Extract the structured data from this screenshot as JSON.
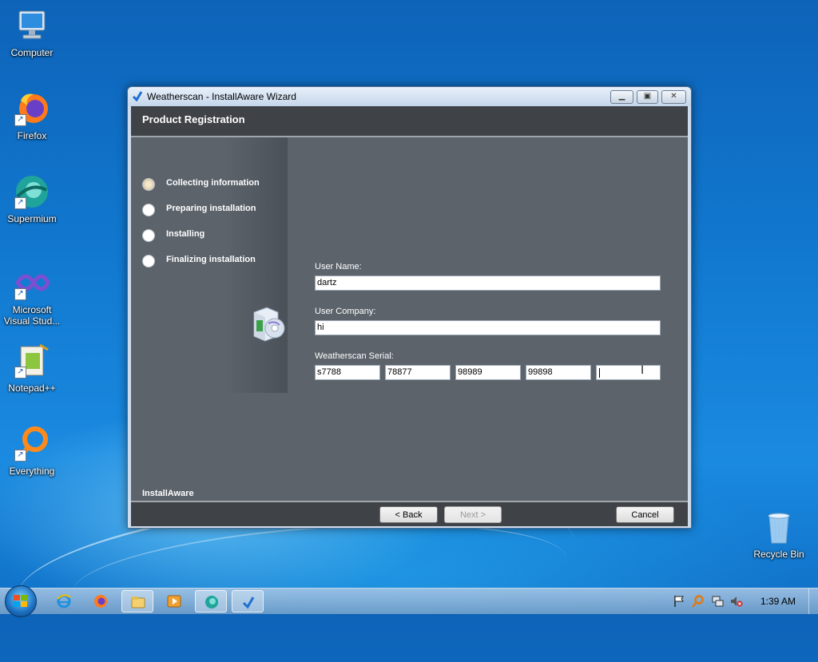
{
  "desktop": {
    "icons": [
      {
        "label": "Computer",
        "icon": "computer-icon"
      },
      {
        "label": "Firefox",
        "icon": "firefox-icon"
      },
      {
        "label": "Supermium",
        "icon": "supermium-icon"
      },
      {
        "label": "Microsoft Visual Stud...",
        "icon": "visual-studio-icon"
      },
      {
        "label": "Notepad++",
        "icon": "notepad-plus-plus-icon"
      },
      {
        "label": "Everything",
        "icon": "everything-search-icon"
      },
      {
        "label": "Recycle Bin",
        "icon": "recycle-bin-icon"
      }
    ]
  },
  "window": {
    "title": "Weatherscan - InstallAware Wizard",
    "controls": {
      "minimize": "minimize",
      "maximize": "maximize",
      "close": "close"
    },
    "header_title": "Product Registration",
    "steps": [
      {
        "label": "Collecting information",
        "active": true
      },
      {
        "label": "Preparing installation",
        "active": false
      },
      {
        "label": "Installing",
        "active": false
      },
      {
        "label": "Finalizing installation",
        "active": false
      }
    ],
    "form": {
      "user_name_label": "User Name:",
      "user_name_value": "dartz",
      "user_company_label": "User Company:",
      "user_company_value": "hi",
      "serial_label": "Weatherscan Serial:",
      "serial_values": [
        "s7788",
        "78877",
        "98989",
        "99898",
        ""
      ]
    },
    "brand": "InstallAware",
    "buttons": {
      "back": "< Back",
      "next": "Next >",
      "cancel": "Cancel"
    },
    "next_enabled": false
  },
  "taskbar": {
    "pinned": [
      "internet-explorer-icon",
      "firefox-icon",
      "file-explorer-icon",
      "media-player-icon",
      "supermium-icon",
      "installaware-icon"
    ],
    "clock": "1:39 AM",
    "tray": [
      "action-center-flag-icon",
      "search-icon",
      "network-icon",
      "volume-muted-icon"
    ]
  },
  "colors": {
    "wizard_body": "#5c636b",
    "wizard_header": "#3f4246",
    "desktop_blue": "#1178cf"
  }
}
